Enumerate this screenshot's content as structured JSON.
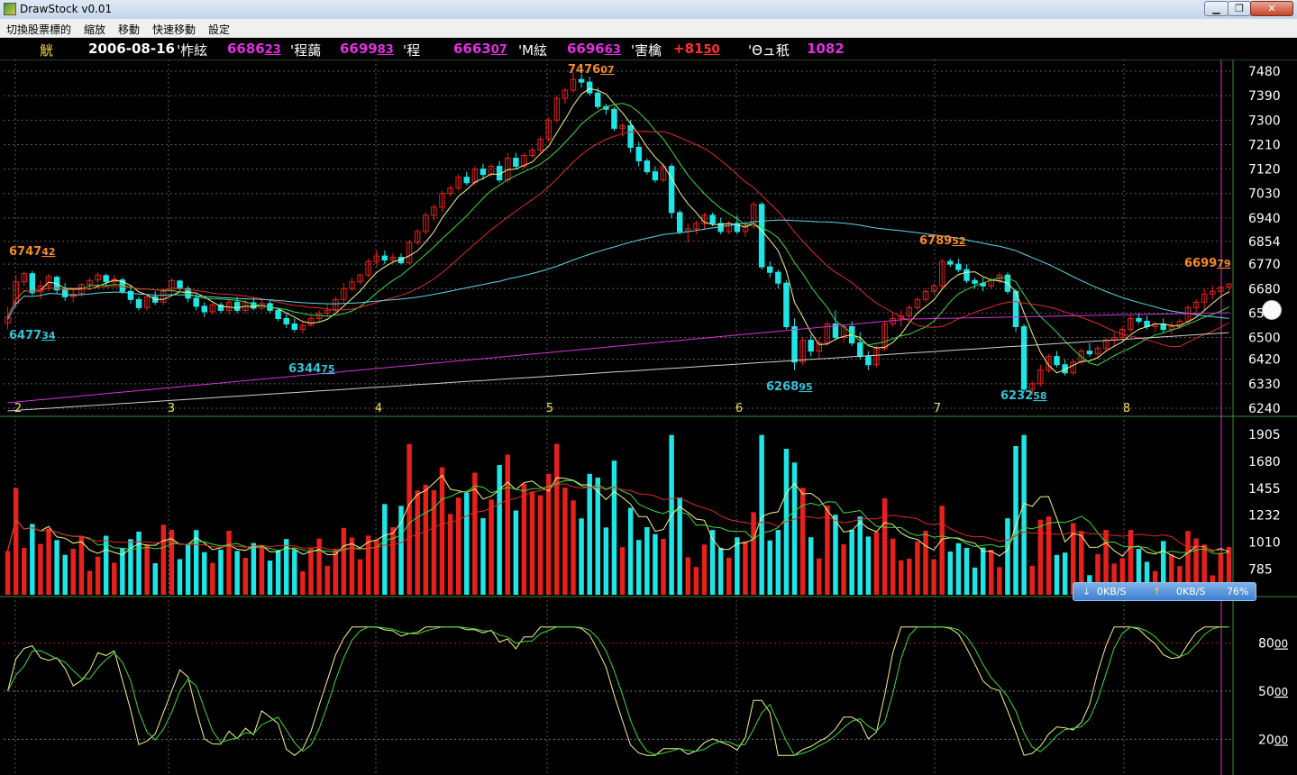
{
  "window": {
    "title": "DrawStock v0.01"
  },
  "menu": {
    "items": [
      "切換股票標的",
      "縮放",
      "移動",
      "快速移動",
      "設定"
    ]
  },
  "quote": {
    "symbol": "觥",
    "date": "2006-08-16",
    "open_label": "'柞絃",
    "open_int": "6686",
    "open_dec": "23",
    "high_label": "'程藹",
    "high_int": "6699",
    "high_dec": "83",
    "low_label": "'程",
    "low_int": "6663",
    "low_dec": "07",
    "close_label": "'M絃",
    "close_int": "6696",
    "close_dec": "63",
    "change_label": "'害檎",
    "change_int": "+81",
    "change_dec": "50",
    "volume_label": "'Θュ秖",
    "volume": "1082"
  },
  "colors": {
    "up": "#e8201c",
    "down": "#1ee6e6",
    "ma5": "#f5f58c",
    "ma10": "#3fd93f",
    "ma20": "#e02a2a",
    "ma60": "#5fd6e6",
    "ma120": "#d733d7",
    "ma240": "#cfcfcf",
    "label_high": "#f58a2a",
    "label_low": "#34c2d6",
    "grid": "#5a5a5a",
    "axis": "#ffffff"
  },
  "chart_data": [
    {
      "type": "candlestick",
      "title": "",
      "x_ticks": [
        "2",
        "3",
        "4",
        "5",
        "6",
        "7",
        "8"
      ],
      "y_ticks": [
        "7480",
        "7390",
        "7300",
        "7210",
        "7120",
        "7030",
        "6940",
        "6854",
        "6770",
        "6680",
        "6590",
        "6500",
        "6420",
        "6330",
        "6240"
      ],
      "ylim": [
        6210,
        7510
      ],
      "candles": [
        [
          6553,
          6613,
          6530,
          6575
        ],
        [
          6625,
          6730,
          6610,
          6705
        ],
        [
          6705,
          6743,
          6690,
          6735
        ],
        [
          6735,
          6745,
          6655,
          6665
        ],
        [
          6668,
          6710,
          6640,
          6690
        ],
        [
          6690,
          6735,
          6670,
          6725
        ],
        [
          6722,
          6728,
          6660,
          6675
        ],
        [
          6678,
          6700,
          6635,
          6650
        ],
        [
          6650,
          6680,
          6630,
          6660
        ],
        [
          6662,
          6700,
          6650,
          6695
        ],
        [
          6695,
          6720,
          6680,
          6710
        ],
        [
          6712,
          6740,
          6700,
          6730
        ],
        [
          6728,
          6735,
          6690,
          6705
        ],
        [
          6705,
          6730,
          6690,
          6715
        ],
        [
          6712,
          6720,
          6660,
          6670
        ],
        [
          6670,
          6690,
          6625,
          6640
        ],
        [
          6640,
          6650,
          6600,
          6610
        ],
        [
          6610,
          6660,
          6600,
          6650
        ],
        [
          6650,
          6670,
          6620,
          6630
        ],
        [
          6630,
          6680,
          6620,
          6670
        ],
        [
          6672,
          6720,
          6660,
          6710
        ],
        [
          6708,
          6712,
          6670,
          6680
        ],
        [
          6680,
          6690,
          6630,
          6645
        ],
        [
          6645,
          6660,
          6600,
          6615
        ],
        [
          6615,
          6630,
          6575,
          6595
        ],
        [
          6595,
          6630,
          6585,
          6620
        ],
        [
          6620,
          6630,
          6590,
          6600
        ],
        [
          6600,
          6640,
          6585,
          6630
        ],
        [
          6630,
          6650,
          6590,
          6600
        ],
        [
          6600,
          6640,
          6590,
          6628
        ],
        [
          6628,
          6650,
          6600,
          6608
        ],
        [
          6608,
          6640,
          6600,
          6625
        ],
        [
          6625,
          6640,
          6590,
          6600
        ],
        [
          6600,
          6610,
          6560,
          6570
        ],
        [
          6570,
          6590,
          6535,
          6550
        ],
        [
          6550,
          6570,
          6520,
          6530
        ],
        [
          6530,
          6560,
          6515,
          6545
        ],
        [
          6545,
          6580,
          6540,
          6570
        ],
        [
          6570,
          6600,
          6560,
          6590
        ],
        [
          6590,
          6620,
          6580,
          6600
        ],
        [
          6600,
          6650,
          6595,
          6640
        ],
        [
          6640,
          6700,
          6630,
          6680
        ],
        [
          6680,
          6720,
          6670,
          6705
        ],
        [
          6705,
          6735,
          6695,
          6730
        ],
        [
          6730,
          6790,
          6720,
          6780
        ],
        [
          6780,
          6820,
          6760,
          6800
        ],
        [
          6800,
          6820,
          6770,
          6785
        ],
        [
          6785,
          6810,
          6770,
          6795
        ],
        [
          6795,
          6810,
          6770,
          6775
        ],
        [
          6775,
          6860,
          6770,
          6850
        ],
        [
          6850,
          6900,
          6840,
          6890
        ],
        [
          6890,
          6960,
          6880,
          6950
        ],
        [
          6950,
          6990,
          6930,
          6980
        ],
        [
          6980,
          7040,
          6960,
          7030
        ],
        [
          7030,
          7060,
          7020,
          7050
        ],
        [
          7050,
          7100,
          7040,
          7090
        ],
        [
          7090,
          7110,
          7060,
          7070
        ],
        [
          7070,
          7130,
          7060,
          7120
        ],
        [
          7120,
          7140,
          7080,
          7100
        ],
        [
          7100,
          7140,
          7090,
          7130
        ],
        [
          7130,
          7150,
          7070,
          7080
        ],
        [
          7080,
          7180,
          7070,
          7160
        ],
        [
          7160,
          7180,
          7120,
          7130
        ],
        [
          7130,
          7180,
          7120,
          7170
        ],
        [
          7170,
          7200,
          7160,
          7190
        ],
        [
          7190,
          7240,
          7180,
          7230
        ],
        [
          7230,
          7310,
          7220,
          7300
        ],
        [
          7300,
          7390,
          7290,
          7380
        ],
        [
          7380,
          7420,
          7360,
          7410
        ],
        [
          7410,
          7476,
          7400,
          7450
        ],
        [
          7450,
          7470,
          7420,
          7440
        ],
        [
          7440,
          7460,
          7390,
          7400
        ],
        [
          7400,
          7420,
          7340,
          7350
        ],
        [
          7350,
          7360,
          7320,
          7340
        ],
        [
          7340,
          7350,
          7260,
          7270
        ],
        [
          7270,
          7290,
          7240,
          7280
        ],
        [
          7280,
          7300,
          7180,
          7200
        ],
        [
          7200,
          7220,
          7130,
          7150
        ],
        [
          7150,
          7160,
          7100,
          7110
        ],
        [
          7110,
          7130,
          7070,
          7080
        ],
        [
          7080,
          7140,
          7070,
          7130
        ],
        [
          7130,
          7140,
          6940,
          6960
        ],
        [
          6960,
          6970,
          6880,
          6890
        ],
        [
          6890,
          6920,
          6850,
          6900
        ],
        [
          6900,
          6930,
          6880,
          6920
        ],
        [
          6920,
          6960,
          6900,
          6950
        ],
        [
          6950,
          6960,
          6910,
          6920
        ],
        [
          6920,
          6940,
          6880,
          6890
        ],
        [
          6890,
          6930,
          6880,
          6920
        ],
        [
          6920,
          6950,
          6880,
          6890
        ],
        [
          6890,
          6930,
          6870,
          6910
        ],
        [
          6910,
          7000,
          6900,
          6990
        ],
        [
          6990,
          7000,
          6750,
          6760
        ],
        [
          6760,
          6780,
          6720,
          6740
        ],
        [
          6740,
          6750,
          6680,
          6700
        ],
        [
          6700,
          6710,
          6530,
          6540
        ],
        [
          6540,
          6570,
          6380,
          6410
        ],
        [
          6410,
          6500,
          6400,
          6490
        ],
        [
          6490,
          6510,
          6430,
          6450
        ],
        [
          6450,
          6500,
          6420,
          6480
        ],
        [
          6480,
          6560,
          6470,
          6550
        ],
        [
          6550,
          6600,
          6490,
          6500
        ],
        [
          6500,
          6550,
          6480,
          6540
        ],
        [
          6540,
          6560,
          6470,
          6480
        ],
        [
          6480,
          6520,
          6420,
          6430
        ],
        [
          6430,
          6450,
          6380,
          6400
        ],
        [
          6400,
          6470,
          6390,
          6460
        ],
        [
          6460,
          6560,
          6450,
          6550
        ],
        [
          6550,
          6590,
          6540,
          6570
        ],
        [
          6570,
          6600,
          6540,
          6580
        ],
        [
          6580,
          6620,
          6570,
          6610
        ],
        [
          6610,
          6650,
          6600,
          6640
        ],
        [
          6640,
          6680,
          6630,
          6670
        ],
        [
          6670,
          6700,
          6660,
          6690
        ],
        [
          6690,
          6790,
          6680,
          6780
        ],
        [
          6780,
          6790,
          6760,
          6770
        ],
        [
          6770,
          6790,
          6740,
          6750
        ],
        [
          6750,
          6770,
          6700,
          6710
        ],
        [
          6710,
          6720,
          6680,
          6700
        ],
        [
          6700,
          6720,
          6670,
          6690
        ],
        [
          6690,
          6720,
          6680,
          6710
        ],
        [
          6710,
          6740,
          6700,
          6730
        ],
        [
          6730,
          6740,
          6660,
          6670
        ],
        [
          6670,
          6680,
          6520,
          6540
        ],
        [
          6540,
          6550,
          6300,
          6310
        ],
        [
          6310,
          6340,
          6290,
          6330
        ],
        [
          6330,
          6400,
          6320,
          6380
        ],
        [
          6380,
          6440,
          6370,
          6430
        ],
        [
          6430,
          6450,
          6390,
          6400
        ],
        [
          6400,
          6420,
          6360,
          6370
        ],
        [
          6370,
          6420,
          6360,
          6410
        ],
        [
          6410,
          6460,
          6400,
          6450
        ],
        [
          6450,
          6480,
          6430,
          6440
        ],
        [
          6440,
          6470,
          6420,
          6460
        ],
        [
          6460,
          6500,
          6450,
          6490
        ],
        [
          6490,
          6520,
          6470,
          6500
        ],
        [
          6500,
          6540,
          6490,
          6530
        ],
        [
          6530,
          6580,
          6520,
          6570
        ],
        [
          6570,
          6590,
          6550,
          6560
        ],
        [
          6560,
          6580,
          6530,
          6540
        ],
        [
          6540,
          6560,
          6520,
          6550
        ],
        [
          6550,
          6570,
          6520,
          6530
        ],
        [
          6530,
          6560,
          6510,
          6540
        ],
        [
          6540,
          6570,
          6530,
          6560
        ],
        [
          6560,
          6620,
          6550,
          6610
        ],
        [
          6610,
          6640,
          6580,
          6630
        ],
        [
          6630,
          6680,
          6600,
          6660
        ],
        [
          6660,
          6690,
          6640,
          6670
        ],
        [
          6670,
          6690,
          6660,
          6685
        ],
        [
          6686,
          6700,
          6663,
          6697
        ]
      ],
      "ma5_start": 6580,
      "ma10_start": 6600,
      "annotations": [
        {
          "text_int": "6747",
          "text_dec": "42",
          "kind": "high",
          "at": "left"
        },
        {
          "text_int": "6477",
          "text_dec": "34",
          "kind": "low",
          "at": "left"
        },
        {
          "text_int": "6344",
          "text_dec": "75",
          "kind": "low",
          "at": "3"
        },
        {
          "text_int": "7476",
          "text_dec": "07",
          "kind": "high",
          "at": "5"
        },
        {
          "text_int": "6268",
          "text_dec": "95",
          "kind": "low",
          "at": "6"
        },
        {
          "text_int": "6789",
          "text_dec": "52",
          "kind": "high",
          "at": "7"
        },
        {
          "text_int": "6232",
          "text_dec": "58",
          "kind": "low",
          "at": "7"
        },
        {
          "text_int": "6699",
          "text_dec": "79",
          "kind": "high",
          "at": "right"
        }
      ]
    },
    {
      "type": "bar",
      "title": "",
      "y_ticks": [
        "1905",
        "1680",
        "1455",
        "1232",
        "1010",
        "785"
      ],
      "ylim": [
        570,
        1950
      ]
    },
    {
      "type": "line",
      "title": "",
      "y_ticks_int": [
        "80",
        "50",
        "20"
      ],
      "y_ticks_dec": [
        "00",
        "00",
        "00"
      ],
      "ylim": [
        0,
        100
      ]
    }
  ],
  "net_meter": {
    "down": "0KB/S",
    "up": "0KB/S",
    "percent": "76%"
  }
}
